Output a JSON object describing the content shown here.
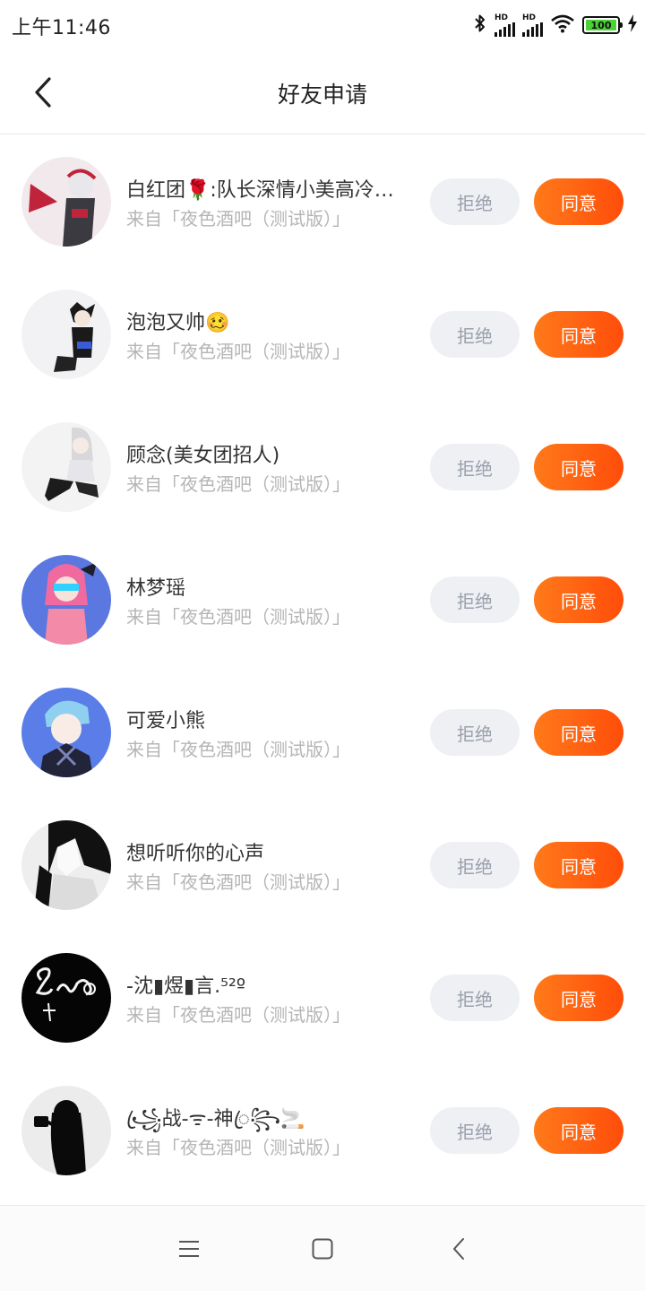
{
  "status": {
    "time": "上午11:46",
    "signal1_label": "HD",
    "signal2_label": "HD",
    "battery": "100"
  },
  "header": {
    "title": "好友申请",
    "back_icon": "chevron-left-icon"
  },
  "requests": [
    {
      "name": "白红团🌹:队长深情小美高冷…",
      "source": "来自「夜色酒吧（测试版）」",
      "reject": "拒绝",
      "accept": "同意",
      "avatar_bg": "#f1e9ec",
      "avatar_fg": "#c0243a"
    },
    {
      "name": "泡泡又帅🥴",
      "source": "来自「夜色酒吧（测试版）」",
      "reject": "拒绝",
      "accept": "同意",
      "avatar_bg": "#f2f2f4",
      "avatar_fg": "#1a1a1a"
    },
    {
      "name": "顾念(美女团招人)",
      "source": "来自「夜色酒吧（测试版）」",
      "reject": "拒绝",
      "accept": "同意",
      "avatar_bg": "#f3f3f3",
      "avatar_fg": "#2a2a2a"
    },
    {
      "name": "林梦瑶",
      "source": "来自「夜色酒吧（测试版）」",
      "reject": "拒绝",
      "accept": "同意",
      "avatar_bg": "#5b77e0",
      "avatar_fg": "#f06aa0"
    },
    {
      "name": "可爱小熊",
      "source": "来自「夜色酒吧（测试版）」",
      "reject": "拒绝",
      "accept": "同意",
      "avatar_bg": "#5a7de8",
      "avatar_fg": "#8fd0f0"
    },
    {
      "name": "想听听你的心声",
      "source": "来自「夜色酒吧（测试版）」",
      "reject": "拒绝",
      "accept": "同意",
      "avatar_bg": "#eeeeee",
      "avatar_fg": "#111111"
    },
    {
      "name": "-沈▮煜▮言.⁵²º",
      "source": "来自「夜色酒吧（测试版）」",
      "reject": "拒绝",
      "accept": "同意",
      "avatar_bg": "#050505",
      "avatar_fg": "#f5f5f5"
    },
    {
      "name": "꧁ꦿ战-ᯤ-神ꦿ꧂🚬",
      "source": "来自「夜色酒吧（测试版）」",
      "reject": "拒绝",
      "accept": "同意",
      "avatar_bg": "#ececec",
      "avatar_fg": "#0a0a0a"
    }
  ],
  "system_nav": {
    "menu_icon": "menu-icon",
    "home_icon": "square-home-icon",
    "back_icon": "triangle-back-icon"
  }
}
